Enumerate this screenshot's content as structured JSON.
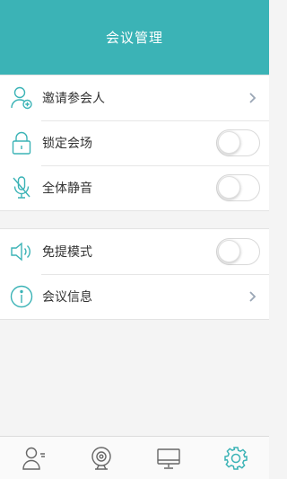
{
  "header": {
    "title": "会议管理"
  },
  "group1": {
    "items": [
      {
        "label": "邀请参会人",
        "icon": "add-user-icon",
        "control": "chevron"
      },
      {
        "label": "锁定会场",
        "icon": "lock-icon",
        "control": "toggle",
        "on": false
      },
      {
        "label": "全体静音",
        "icon": "mute-mic-icon",
        "control": "toggle",
        "on": false
      }
    ]
  },
  "group2": {
    "items": [
      {
        "label": "免提模式",
        "icon": "speaker-icon",
        "control": "toggle",
        "on": false
      },
      {
        "label": "会议信息",
        "icon": "info-icon",
        "control": "chevron"
      }
    ]
  },
  "tabbar": {
    "tabs": [
      {
        "icon": "participants-icon",
        "active": false
      },
      {
        "icon": "camera-icon",
        "active": false
      },
      {
        "icon": "monitor-icon",
        "active": false
      },
      {
        "icon": "settings-icon",
        "active": true
      }
    ]
  },
  "colors": {
    "accent": "#3bb3b6",
    "icon_inactive": "#666666",
    "background": "#f4f4f4"
  }
}
